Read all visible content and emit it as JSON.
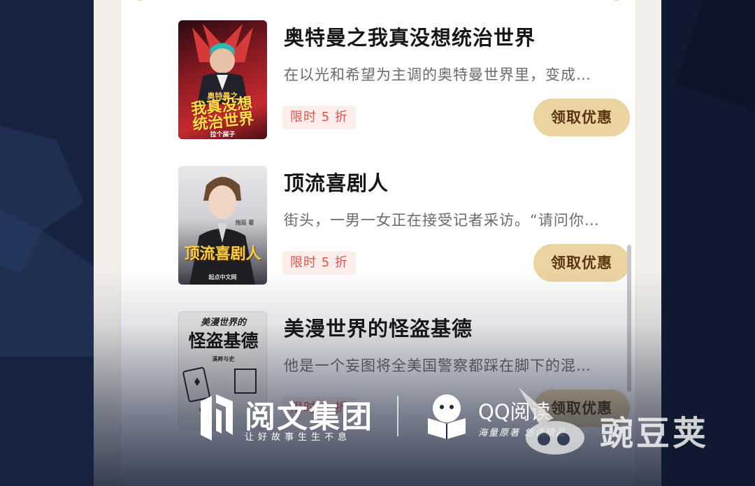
{
  "books": [
    {
      "title": "奥特曼之我真没想统治世界",
      "description": "在以光和希望为主调的奥特曼世界里，变成…",
      "tag": "限时 5 折",
      "button": "领取优惠",
      "cover": {
        "top_text": "奥特曼之",
        "main_text": "我真没想\n统治世界",
        "author": "拉个屎子",
        "colors": [
          "#3a0d12",
          "#c0262d"
        ]
      }
    },
    {
      "title": "顶流喜剧人",
      "description": "街头，一男一女正在接受记者采访。“请问你…",
      "tag": "限时 5 折",
      "button": "领取优惠",
      "cover": {
        "main_text": "顶流喜剧人",
        "author": "拖延 著",
        "publisher": "起点中文网",
        "colors": [
          "#d9d9dc",
          "#3a3a42"
        ]
      }
    },
    {
      "title": "美漫世界的怪盗基德",
      "description": "他是一个妄图将全美国警察都踩在脚下的混…",
      "tag": "限时 5 折",
      "button": "领取优惠",
      "cover": {
        "top_text": "美漫世界的",
        "main_text": "怪盗基德",
        "author": "溪畔与史",
        "colors": [
          "#f2f0ec",
          "#d8d6d0"
        ]
      }
    }
  ],
  "watermark": {
    "yuewen_name": "阅文集团",
    "yuewen_slogan": "让好故事生生不息",
    "qq_name": "QQ阅读",
    "qq_slogan": "海量原著 悠读精品",
    "wandoujia_name": "豌豆荚"
  },
  "colors": {
    "accent_button": "#ecd4a2",
    "button_text": "#5a3410",
    "tag_text": "#e5534b",
    "tag_bg": "#fdeeec",
    "background": "#142038"
  }
}
